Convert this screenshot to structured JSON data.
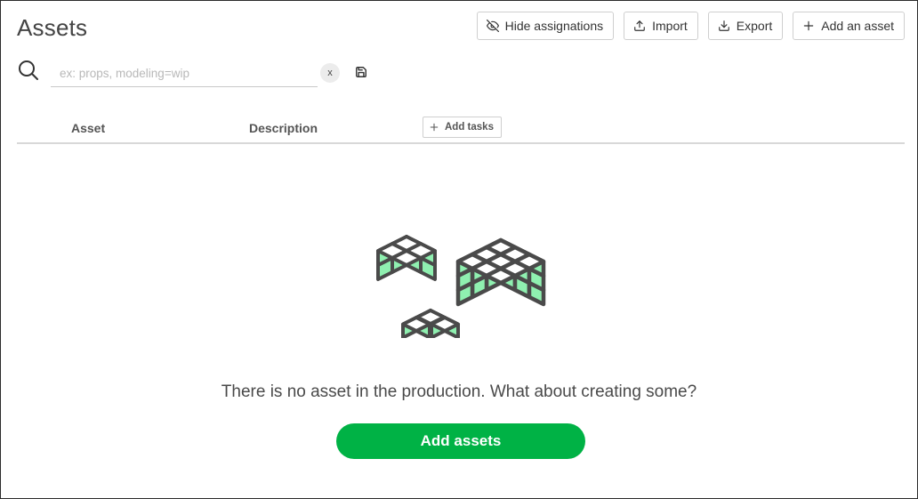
{
  "page": {
    "title": "Assets"
  },
  "toolbar": {
    "hide_assignations": "Hide assignations",
    "import": "Import",
    "export": "Export",
    "add_asset": "Add an asset"
  },
  "search": {
    "placeholder": "ex: props, modeling=wip",
    "value": "",
    "clear_label": "x"
  },
  "table": {
    "columns": [
      "Asset",
      "Description"
    ],
    "add_tasks": "Add tasks"
  },
  "empty_state": {
    "message": "There is no asset in the production. What about creating some?",
    "cta": "Add assets"
  },
  "colors": {
    "accent_green": "#00b245",
    "cube_fill": "#8ff0b0",
    "cube_stroke": "#4a4a4a"
  },
  "icons": {
    "hide": "eye-off-icon",
    "import": "upload-icon",
    "export": "download-icon",
    "add": "plus-icon",
    "search": "search-icon",
    "save": "save-icon"
  }
}
